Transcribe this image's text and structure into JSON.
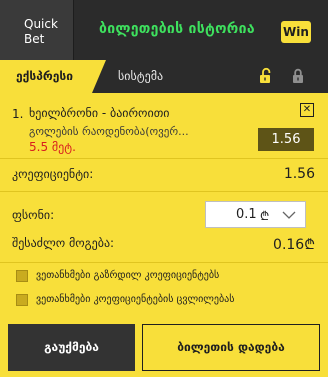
{
  "header": {
    "quick_bet_line1": "Quick",
    "quick_bet_line2": "Bet",
    "history_label": "ბილეთების ისტორია",
    "win_badge": "Win"
  },
  "tabs": {
    "express": "ექსპრესი",
    "system": "სისტემა",
    "unlock_icon": "unlock-icon",
    "lock_icon": "lock-icon"
  },
  "bet": {
    "number": "1.",
    "title": "ხეილბრონი - ბაიროითი",
    "market": "გოლების რაოდენობა(ოვერ...",
    "selection": "5.5 მეტ.",
    "odd": "1.56"
  },
  "coefficient": {
    "label": "კოეფიციენტი:",
    "value": "1.56"
  },
  "stake": {
    "label": "ფსონი:",
    "value": "0.1",
    "currency": "₾"
  },
  "possible_win": {
    "label": "შესაძლო მოგება:",
    "value": "0.16₾"
  },
  "options": [
    {
      "label": "ვეთანხმები გაზრდილ კოეფიციენტებს"
    },
    {
      "label": "ვეთანხმები კოეფიციენტების ცვლილებას"
    }
  ],
  "buttons": {
    "clear": "გაუქმება",
    "place": "ბილეთის დადება"
  },
  "colors": {
    "accent": "#f8df3a",
    "green": "#3ee15e",
    "odd_box": "#5e5417",
    "selection": "#d81e1e"
  }
}
